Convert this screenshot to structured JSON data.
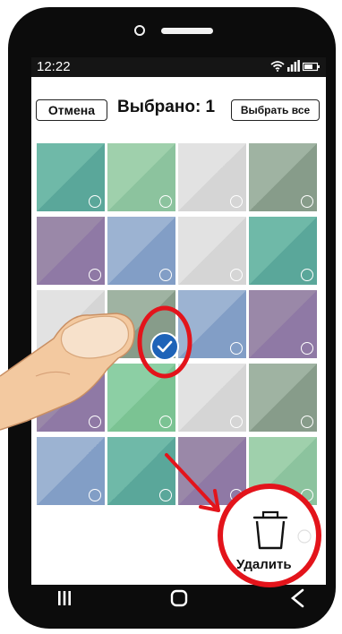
{
  "status": {
    "time": "12:22"
  },
  "header": {
    "cancel_label": "Отмена",
    "title": "Выбрано: 1",
    "select_all_label": "Выбрать все"
  },
  "grid": {
    "tiles": [
      {
        "c1": "#6fb9a8",
        "c2": "#5aa79a"
      },
      {
        "c1": "#9fd0ac",
        "c2": "#8cc39e"
      },
      {
        "c1": "#e2e2e2",
        "c2": "#d5d5d5"
      },
      {
        "c1": "#9fb3a2",
        "c2": "#879c8a"
      },
      {
        "c1": "#9a88a8",
        "c2": "#8f79a5"
      },
      {
        "c1": "#9cb3d2",
        "c2": "#829ec6"
      },
      {
        "c1": "#e2e2e2",
        "c2": "#d5d5d5"
      },
      {
        "c1": "#6fb9a8",
        "c2": "#5aa79a"
      },
      {
        "c1": "#e2e2e2",
        "c2": "#d5d5d5"
      },
      {
        "c1": "#9fb3a2",
        "c2": "#879c8a"
      },
      {
        "c1": "#9cb3d2",
        "c2": "#829ec6"
      },
      {
        "c1": "#9a88a8",
        "c2": "#8f79a5"
      },
      {
        "c1": "#9a88a8",
        "c2": "#8f79a5"
      },
      {
        "c1": "#8ccfa4",
        "c2": "#7bc393"
      },
      {
        "c1": "#e2e2e2",
        "c2": "#d5d5d5"
      },
      {
        "c1": "#9fb3a2",
        "c2": "#879c8a"
      },
      {
        "c1": "#9cb3d2",
        "c2": "#829ec6"
      },
      {
        "c1": "#6fb9a8",
        "c2": "#5aa79a"
      },
      {
        "c1": "#9a88a8",
        "c2": "#8f79a5"
      },
      {
        "c1": "#9fd0ac",
        "c2": "#8cc39e"
      }
    ],
    "selected_index": 9
  },
  "delete": {
    "label": "Удалить"
  },
  "colors": {
    "annotation_red": "#e3141b",
    "check_blue": "#1e63b8"
  }
}
